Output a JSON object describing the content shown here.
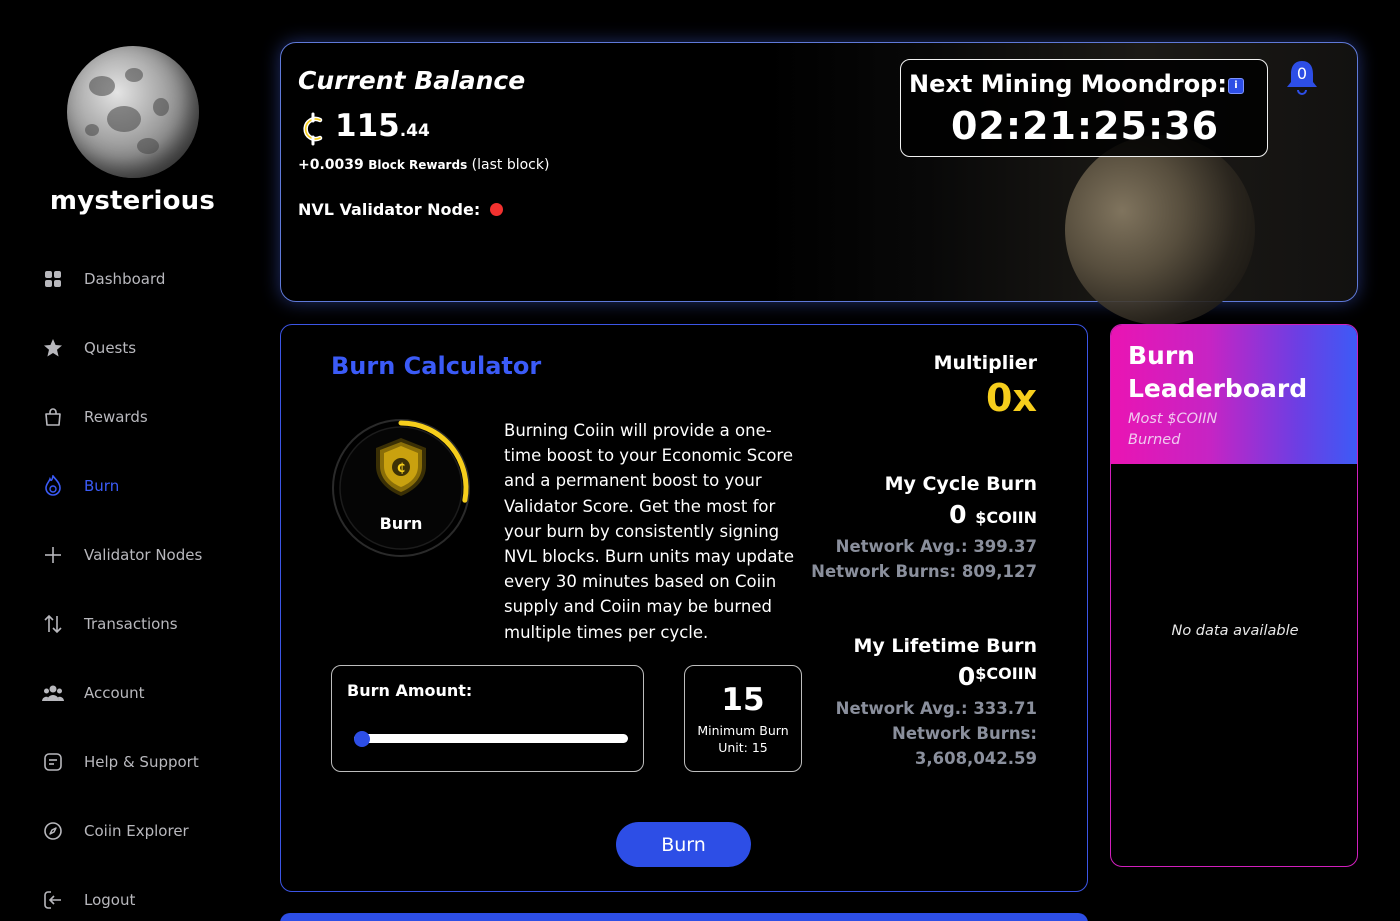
{
  "user": {
    "name": "mysterious"
  },
  "nav": {
    "items": [
      {
        "label": "Dashboard",
        "icon": "grid-icon"
      },
      {
        "label": "Quests",
        "icon": "star-icon"
      },
      {
        "label": "Rewards",
        "icon": "bag-icon"
      },
      {
        "label": "Burn",
        "icon": "flame-coin-icon",
        "active": true
      },
      {
        "label": "Validator Nodes",
        "icon": "plus-icon"
      },
      {
        "label": "Transactions",
        "icon": "arrows-updown-icon"
      },
      {
        "label": "Account",
        "icon": "users-icon"
      },
      {
        "label": "Help & Support",
        "icon": "document-icon"
      },
      {
        "label": "Coiin Explorer",
        "icon": "compass-icon"
      },
      {
        "label": "Logout",
        "icon": "logout-icon"
      }
    ]
  },
  "balance": {
    "title": "Current Balance",
    "amount_whole": "115",
    "amount_decimal": ".44",
    "reward_value": "+0.0039",
    "reward_label": "Block Rewards",
    "reward_note": "(last block)",
    "node_label": "NVL Validator Node:",
    "node_status_color": "#f2312f"
  },
  "moondrop": {
    "title": "Next Mining Moondrop:",
    "info_icon": "i",
    "countdown": "02:21:25:36"
  },
  "notifications": {
    "count": "0"
  },
  "burn_calculator": {
    "title": "Burn Calculator",
    "ring_label": "Burn",
    "ring_progress": 0.28,
    "description": "Burning Coiin will provide a one-time boost to your Economic Score and a permanent boost to your Validator Score. Get the most for your burn by consistently signing NVL blocks. Burn units may update every 30 minutes based on Coiin supply and Coiin may be burned multiple times per cycle.",
    "amount_label": "Burn Amount:",
    "slider_value": 0,
    "min_unit_value": "15",
    "min_unit_label": "Minimum Burn Unit: 15",
    "burn_button": "Burn",
    "multiplier_label": "Multiplier",
    "multiplier_value": "0x",
    "cycle_title": "My Cycle Burn",
    "cycle_value": "0",
    "cycle_unit": "$COIIN",
    "cycle_avg": "Network Avg.: 399.37",
    "cycle_burns": "Network Burns: 809,127",
    "lifetime_title": "My Lifetime Burn",
    "lifetime_value": "0",
    "lifetime_unit": "$COIIN",
    "lifetime_avg": "Network Avg.: 333.71",
    "lifetime_burns_label": "Network Burns:",
    "lifetime_burns_value": "3,608,042.59"
  },
  "leaderboard": {
    "title_line1": "Burn",
    "title_line2": "Leaderboard",
    "subtitle_line1": "Most $COIIN",
    "subtitle_line2": "Burned",
    "empty": "No data available"
  },
  "colors": {
    "accent": "#2d4ee6",
    "gold": "#f6ce1c",
    "pink": "#ea14b3"
  }
}
